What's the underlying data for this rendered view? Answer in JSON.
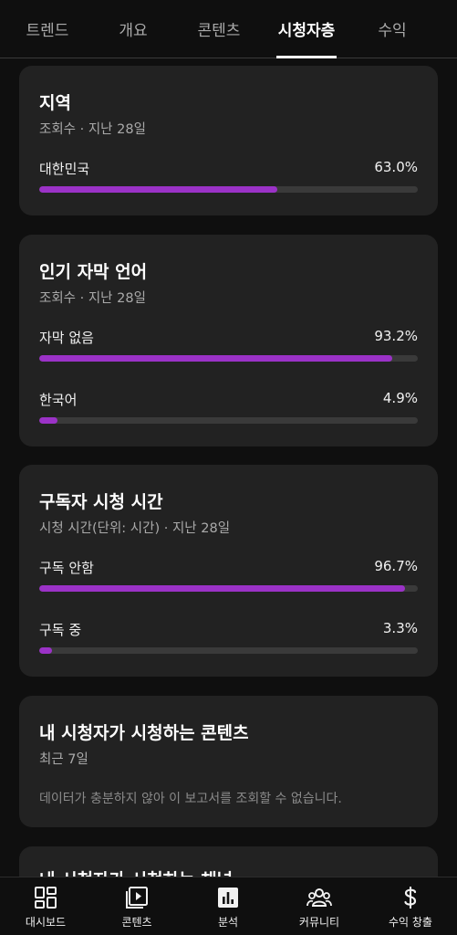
{
  "tabs": [
    {
      "label": "트렌드"
    },
    {
      "label": "개요"
    },
    {
      "label": "콘텐츠"
    },
    {
      "label": "시청자층"
    },
    {
      "label": "수익"
    }
  ],
  "active_tab": "시청자층",
  "cards": {
    "region": {
      "title": "지역",
      "subtitle": "조회수 · 지난 28일",
      "rows": [
        {
          "label": "대한민국",
          "value": "63.0%",
          "fraction": 0.63
        }
      ]
    },
    "subtitle_lang": {
      "title": "인기 자막 언어",
      "subtitle": "조회수 · 지난 28일",
      "rows": [
        {
          "label": "자막 없음",
          "value": "93.2%",
          "fraction": 0.932
        },
        {
          "label": "한국어",
          "value": "4.9%",
          "fraction": 0.049
        }
      ]
    },
    "subscriber_watch": {
      "title": "구독자 시청 시간",
      "subtitle": "시청 시간(단위: 시간) · 지난 28일",
      "rows": [
        {
          "label": "구독 안함",
          "value": "96.7%",
          "fraction": 0.967
        },
        {
          "label": "구독 중",
          "value": "3.3%",
          "fraction": 0.033
        }
      ]
    },
    "viewer_content": {
      "title": "내 시청자가 시청하는 콘텐츠",
      "subtitle": "최근 7일",
      "note": "데이터가 충분하지 않아 이 보고서를 조회할 수 없습니다."
    },
    "viewer_channels": {
      "title": "내 시청자가 시청하는 채널"
    }
  },
  "bottom_nav": [
    {
      "label": "대시보드",
      "icon": "dashboard-icon"
    },
    {
      "label": "콘텐츠",
      "icon": "content-icon"
    },
    {
      "label": "분석",
      "icon": "analytics-icon"
    },
    {
      "label": "커뮤니티",
      "icon": "community-icon"
    },
    {
      "label": "수익 창출",
      "icon": "dollar-icon"
    }
  ],
  "colors": {
    "background": "#0f0f0f",
    "card": "#222222",
    "bar_fill": "#9b32c7",
    "bar_track": "#3a3a3a"
  }
}
